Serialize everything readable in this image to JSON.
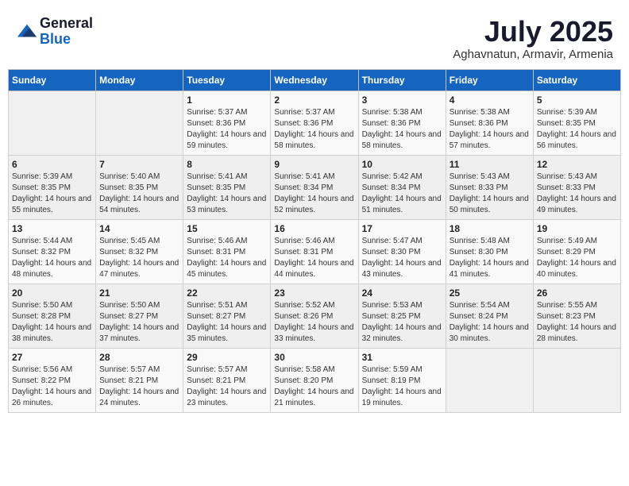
{
  "header": {
    "logo_general": "General",
    "logo_blue": "Blue",
    "month_year": "July 2025",
    "location": "Aghavnatun, Armavir, Armenia"
  },
  "weekdays": [
    "Sunday",
    "Monday",
    "Tuesday",
    "Wednesday",
    "Thursday",
    "Friday",
    "Saturday"
  ],
  "weeks": [
    [
      {
        "day": "",
        "empty": true
      },
      {
        "day": "",
        "empty": true
      },
      {
        "day": "1",
        "sunrise": "5:37 AM",
        "sunset": "8:36 PM",
        "daylight": "14 hours and 59 minutes."
      },
      {
        "day": "2",
        "sunrise": "5:37 AM",
        "sunset": "8:36 PM",
        "daylight": "14 hours and 58 minutes."
      },
      {
        "day": "3",
        "sunrise": "5:38 AM",
        "sunset": "8:36 PM",
        "daylight": "14 hours and 58 minutes."
      },
      {
        "day": "4",
        "sunrise": "5:38 AM",
        "sunset": "8:36 PM",
        "daylight": "14 hours and 57 minutes."
      },
      {
        "day": "5",
        "sunrise": "5:39 AM",
        "sunset": "8:35 PM",
        "daylight": "14 hours and 56 minutes."
      }
    ],
    [
      {
        "day": "6",
        "sunrise": "5:39 AM",
        "sunset": "8:35 PM",
        "daylight": "14 hours and 55 minutes."
      },
      {
        "day": "7",
        "sunrise": "5:40 AM",
        "sunset": "8:35 PM",
        "daylight": "14 hours and 54 minutes."
      },
      {
        "day": "8",
        "sunrise": "5:41 AM",
        "sunset": "8:35 PM",
        "daylight": "14 hours and 53 minutes."
      },
      {
        "day": "9",
        "sunrise": "5:41 AM",
        "sunset": "8:34 PM",
        "daylight": "14 hours and 52 minutes."
      },
      {
        "day": "10",
        "sunrise": "5:42 AM",
        "sunset": "8:34 PM",
        "daylight": "14 hours and 51 minutes."
      },
      {
        "day": "11",
        "sunrise": "5:43 AM",
        "sunset": "8:33 PM",
        "daylight": "14 hours and 50 minutes."
      },
      {
        "day": "12",
        "sunrise": "5:43 AM",
        "sunset": "8:33 PM",
        "daylight": "14 hours and 49 minutes."
      }
    ],
    [
      {
        "day": "13",
        "sunrise": "5:44 AM",
        "sunset": "8:32 PM",
        "daylight": "14 hours and 48 minutes."
      },
      {
        "day": "14",
        "sunrise": "5:45 AM",
        "sunset": "8:32 PM",
        "daylight": "14 hours and 47 minutes."
      },
      {
        "day": "15",
        "sunrise": "5:46 AM",
        "sunset": "8:31 PM",
        "daylight": "14 hours and 45 minutes."
      },
      {
        "day": "16",
        "sunrise": "5:46 AM",
        "sunset": "8:31 PM",
        "daylight": "14 hours and 44 minutes."
      },
      {
        "day": "17",
        "sunrise": "5:47 AM",
        "sunset": "8:30 PM",
        "daylight": "14 hours and 43 minutes."
      },
      {
        "day": "18",
        "sunrise": "5:48 AM",
        "sunset": "8:30 PM",
        "daylight": "14 hours and 41 minutes."
      },
      {
        "day": "19",
        "sunrise": "5:49 AM",
        "sunset": "8:29 PM",
        "daylight": "14 hours and 40 minutes."
      }
    ],
    [
      {
        "day": "20",
        "sunrise": "5:50 AM",
        "sunset": "8:28 PM",
        "daylight": "14 hours and 38 minutes."
      },
      {
        "day": "21",
        "sunrise": "5:50 AM",
        "sunset": "8:27 PM",
        "daylight": "14 hours and 37 minutes."
      },
      {
        "day": "22",
        "sunrise": "5:51 AM",
        "sunset": "8:27 PM",
        "daylight": "14 hours and 35 minutes."
      },
      {
        "day": "23",
        "sunrise": "5:52 AM",
        "sunset": "8:26 PM",
        "daylight": "14 hours and 33 minutes."
      },
      {
        "day": "24",
        "sunrise": "5:53 AM",
        "sunset": "8:25 PM",
        "daylight": "14 hours and 32 minutes."
      },
      {
        "day": "25",
        "sunrise": "5:54 AM",
        "sunset": "8:24 PM",
        "daylight": "14 hours and 30 minutes."
      },
      {
        "day": "26",
        "sunrise": "5:55 AM",
        "sunset": "8:23 PM",
        "daylight": "14 hours and 28 minutes."
      }
    ],
    [
      {
        "day": "27",
        "sunrise": "5:56 AM",
        "sunset": "8:22 PM",
        "daylight": "14 hours and 26 minutes."
      },
      {
        "day": "28",
        "sunrise": "5:57 AM",
        "sunset": "8:21 PM",
        "daylight": "14 hours and 24 minutes."
      },
      {
        "day": "29",
        "sunrise": "5:57 AM",
        "sunset": "8:21 PM",
        "daylight": "14 hours and 23 minutes."
      },
      {
        "day": "30",
        "sunrise": "5:58 AM",
        "sunset": "8:20 PM",
        "daylight": "14 hours and 21 minutes."
      },
      {
        "day": "31",
        "sunrise": "5:59 AM",
        "sunset": "8:19 PM",
        "daylight": "14 hours and 19 minutes."
      },
      {
        "day": "",
        "empty": true
      },
      {
        "day": "",
        "empty": true
      }
    ]
  ],
  "labels": {
    "sunrise": "Sunrise:",
    "sunset": "Sunset:",
    "daylight": "Daylight:"
  }
}
